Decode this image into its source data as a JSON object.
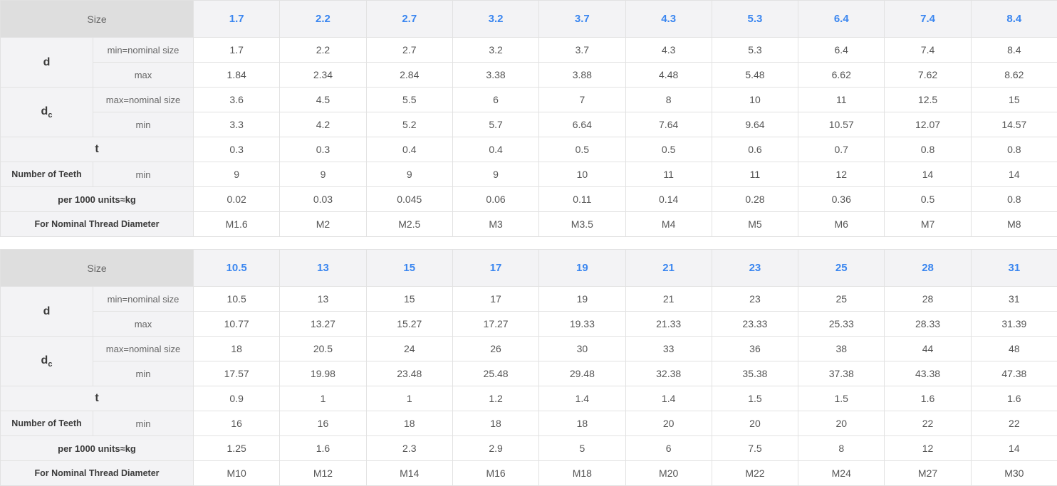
{
  "tables": [
    {
      "size_label": "Size",
      "sizes": [
        "1.7",
        "2.2",
        "2.7",
        "3.2",
        "3.7",
        "4.3",
        "5.3",
        "6.4",
        "7.4",
        "8.4"
      ],
      "d": {
        "label": "d",
        "min_label": "min=nominal size",
        "min": [
          "1.7",
          "2.2",
          "2.7",
          "3.2",
          "3.7",
          "4.3",
          "5.3",
          "6.4",
          "7.4",
          "8.4"
        ],
        "max_label": "max",
        "max": [
          "1.84",
          "2.34",
          "2.84",
          "3.38",
          "3.88",
          "4.48",
          "5.48",
          "6.62",
          "7.62",
          "8.62"
        ]
      },
      "dc": {
        "label": "d",
        "label_sub": "c",
        "max_label": "max=nominal size",
        "max": [
          "3.6",
          "4.5",
          "5.5",
          "6",
          "7",
          "8",
          "10",
          "11",
          "12.5",
          "15"
        ],
        "min_label": "min",
        "min": [
          "3.3",
          "4.2",
          "5.2",
          "5.7",
          "6.64",
          "7.64",
          "9.64",
          "10.57",
          "12.07",
          "14.57"
        ]
      },
      "t": {
        "label": "t",
        "values": [
          "0.3",
          "0.3",
          "0.4",
          "0.4",
          "0.5",
          "0.5",
          "0.6",
          "0.7",
          "0.8",
          "0.8"
        ]
      },
      "teeth": {
        "label": "Number of Teeth",
        "sub_label": "min",
        "values": [
          "9",
          "9",
          "9",
          "9",
          "10",
          "11",
          "11",
          "12",
          "14",
          "14"
        ]
      },
      "weight": {
        "label": "per 1000 units≈kg",
        "values": [
          "0.02",
          "0.03",
          "0.045",
          "0.06",
          "0.11",
          "0.14",
          "0.28",
          "0.36",
          "0.5",
          "0.8"
        ]
      },
      "thread": {
        "label": "For Nominal Thread Diameter",
        "values": [
          "M1.6",
          "M2",
          "M2.5",
          "M3",
          "M3.5",
          "M4",
          "M5",
          "M6",
          "M7",
          "M8"
        ]
      }
    },
    {
      "size_label": "Size",
      "sizes": [
        "10.5",
        "13",
        "15",
        "17",
        "19",
        "21",
        "23",
        "25",
        "28",
        "31"
      ],
      "d": {
        "label": "d",
        "min_label": "min=nominal size",
        "min": [
          "10.5",
          "13",
          "15",
          "17",
          "19",
          "21",
          "23",
          "25",
          "28",
          "31"
        ],
        "max_label": "max",
        "max": [
          "10.77",
          "13.27",
          "15.27",
          "17.27",
          "19.33",
          "21.33",
          "23.33",
          "25.33",
          "28.33",
          "31.39"
        ]
      },
      "dc": {
        "label": "d",
        "label_sub": "c",
        "max_label": "max=nominal size",
        "max": [
          "18",
          "20.5",
          "24",
          "26",
          "30",
          "33",
          "36",
          "38",
          "44",
          "48"
        ],
        "min_label": "min",
        "min": [
          "17.57",
          "19.98",
          "23.48",
          "25.48",
          "29.48",
          "32.38",
          "35.38",
          "37.38",
          "43.38",
          "47.38"
        ]
      },
      "t": {
        "label": "t",
        "values": [
          "0.9",
          "1",
          "1",
          "1.2",
          "1.4",
          "1.4",
          "1.5",
          "1.5",
          "1.6",
          "1.6"
        ]
      },
      "teeth": {
        "label": "Number of Teeth",
        "sub_label": "min",
        "values": [
          "16",
          "16",
          "18",
          "18",
          "18",
          "20",
          "20",
          "20",
          "22",
          "22"
        ]
      },
      "weight": {
        "label": "per 1000 units≈kg",
        "values": [
          "1.25",
          "1.6",
          "2.3",
          "2.9",
          "5",
          "6",
          "7.5",
          "8",
          "12",
          "14"
        ]
      },
      "thread": {
        "label": "For Nominal Thread Diameter",
        "values": [
          "M10",
          "M12",
          "M14",
          "M16",
          "M18",
          "M20",
          "M22",
          "M24",
          "M27",
          "M30"
        ]
      }
    }
  ]
}
